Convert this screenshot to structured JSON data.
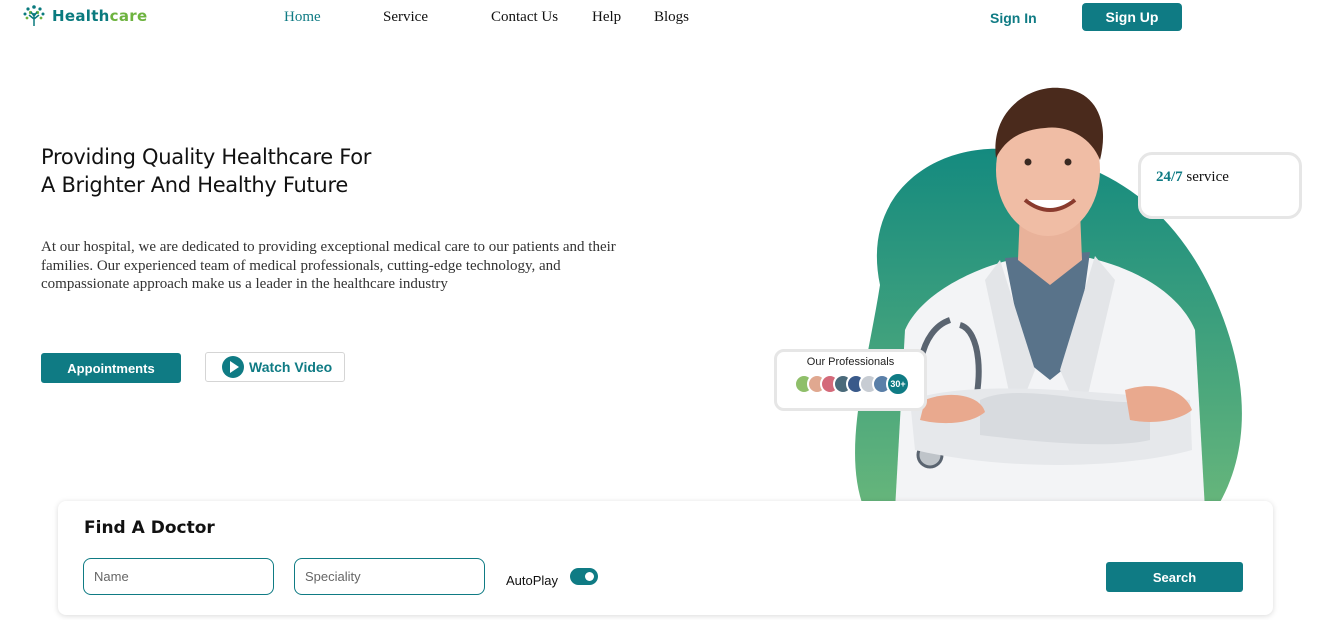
{
  "brand": {
    "part1": "Health",
    "part2": "care"
  },
  "nav": {
    "items": [
      {
        "label": "Home",
        "active": true
      },
      {
        "label": "Service",
        "active": false
      },
      {
        "label": "Contact Us",
        "active": false
      },
      {
        "label": "Help",
        "active": false
      },
      {
        "label": "Blogs",
        "active": false
      }
    ],
    "signin": "Sign In",
    "signup": "Sign Up"
  },
  "hero": {
    "title_lines": [
      "Providing Quality Healthcare For",
      "A Brighter And Healthy Future"
    ],
    "description_lines": [
      "At our hospital, we are dedicated to providing exceptional medical care to our patients and their",
      "families. Our experienced team of medical professionals, cutting-edge technology, and",
      "compassionate approach make us a leader in the healthcare industry"
    ],
    "appointments_label": "Appointments",
    "watch_video_label": "Watch Video"
  },
  "service_badge": {
    "number": "24/7",
    "text": "service"
  },
  "professionals": {
    "title": "Our Professionals",
    "count": "30+"
  },
  "find_doctor": {
    "title": "Find A Doctor",
    "name_placeholder": "Name",
    "speciality_placeholder": "Speciality",
    "autoplay_label": "AutoPlay",
    "autoplay_on": true,
    "search_label": "Search"
  },
  "colors": {
    "primary": "#0f7b84",
    "brand_green": "#6db33f",
    "blob_top": "#148a7f",
    "blob_bottom": "#7cc17a"
  }
}
